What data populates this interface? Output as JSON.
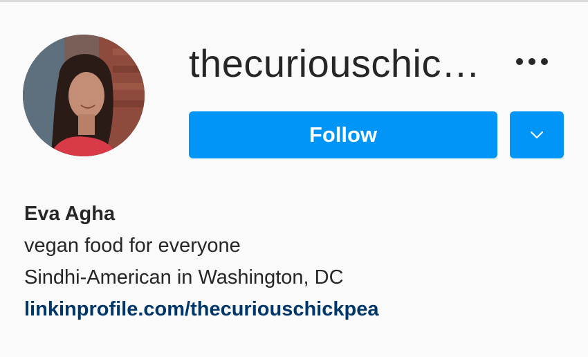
{
  "profile": {
    "username": "thecuriouschic…",
    "follow_label": "Follow",
    "full_name": "Eva Agha",
    "bio_lines": [
      "vegan food for everyone",
      "Sindhi-American in Washington, DC"
    ],
    "link": "linkinprofile.com/thecuriouschickpea"
  },
  "icons": {
    "more": "more-horizontal-icon",
    "dropdown": "chevron-down-icon"
  },
  "colors": {
    "background": "#fafafa",
    "accent": "#0095f6",
    "link": "#00376b",
    "text": "#262626"
  }
}
